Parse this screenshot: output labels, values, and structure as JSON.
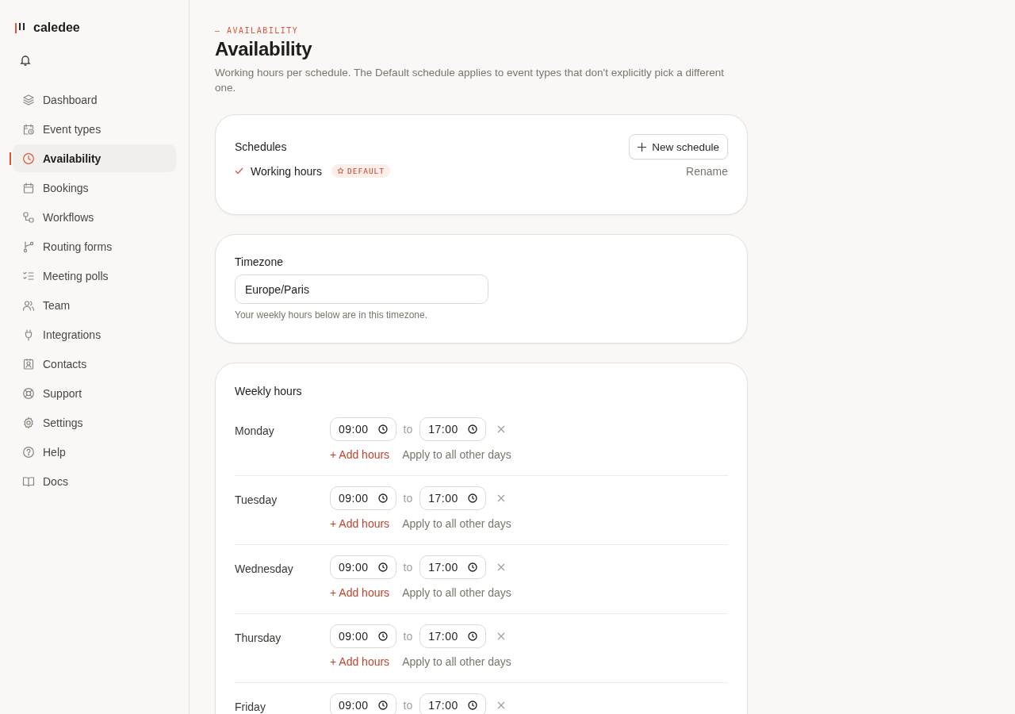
{
  "brand": {
    "name": "caledee"
  },
  "nav": [
    {
      "label": "Dashboard",
      "selected": false
    },
    {
      "label": "Event types",
      "selected": false
    },
    {
      "label": "Availability",
      "selected": true
    },
    {
      "label": "Bookings",
      "selected": false
    },
    {
      "label": "Workflows",
      "selected": false
    },
    {
      "label": "Routing forms",
      "selected": false
    },
    {
      "label": "Meeting polls",
      "selected": false
    },
    {
      "label": "Team",
      "selected": false
    },
    {
      "label": "Integrations",
      "selected": false
    },
    {
      "label": "Contacts",
      "selected": false
    },
    {
      "label": "Support",
      "selected": false
    },
    {
      "label": "Settings",
      "selected": false
    },
    {
      "label": "Help",
      "selected": false
    },
    {
      "label": "Docs",
      "selected": false
    }
  ],
  "header": {
    "eyebrow": "— AVAILABILITY",
    "title": "Availability",
    "description": "Working hours per schedule. The Default schedule applies to event types that don't explicitly pick a different one."
  },
  "schedules": {
    "title": "Schedules",
    "new_button": "New schedule",
    "items": [
      {
        "name": "Working hours",
        "selected": true,
        "badge": "DEFAULT",
        "action": "Rename"
      }
    ]
  },
  "timezone": {
    "label": "Timezone",
    "value": "Europe/Paris",
    "hint": "Your weekly hours below are in this timezone."
  },
  "weekly": {
    "title": "Weekly hours",
    "days": [
      {
        "day": "Monday",
        "start": "09:00",
        "separator": "to",
        "end": "17:00",
        "add_label": "+ Add hours",
        "apply_label": "Apply to all other days"
      },
      {
        "day": "Tuesday",
        "start": "09:00",
        "separator": "to",
        "end": "17:00",
        "add_label": "+ Add hours",
        "apply_label": "Apply to all other days"
      },
      {
        "day": "Wednesday",
        "start": "09:00",
        "separator": "to",
        "end": "17:00",
        "add_label": "+ Add hours",
        "apply_label": "Apply to all other days"
      },
      {
        "day": "Thursday",
        "start": "09:00",
        "separator": "to",
        "end": "17:00",
        "add_label": "+ Add hours",
        "apply_label": "Apply to all other days"
      },
      {
        "day": "Friday",
        "start": "09:00",
        "separator": "to",
        "end": "17:00"
      }
    ]
  }
}
